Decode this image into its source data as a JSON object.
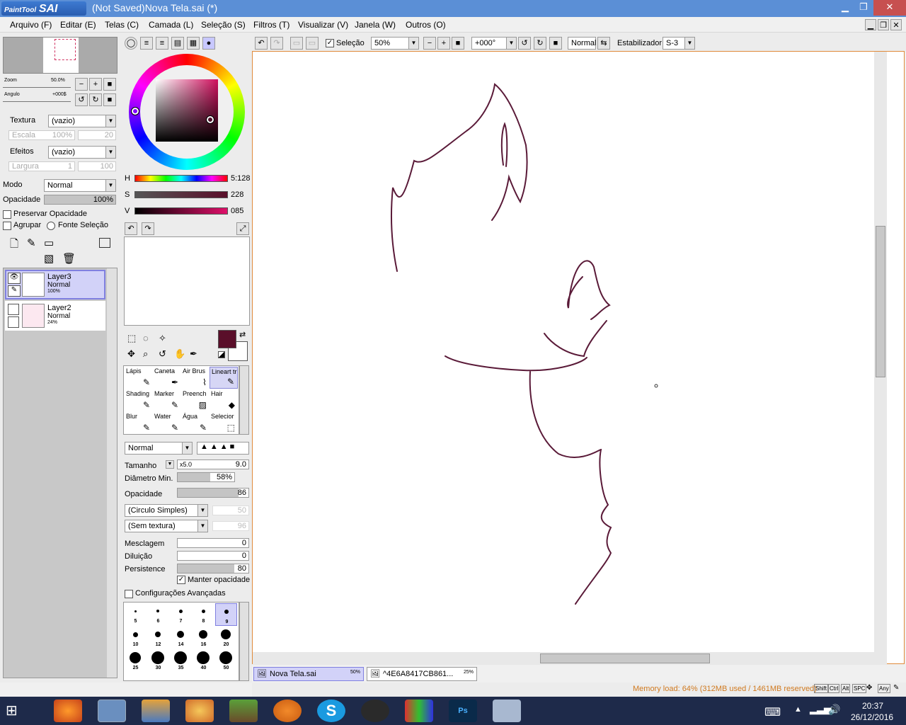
{
  "window": {
    "logo_small": "PaintTool",
    "logo_big": "SAI",
    "title": "(Not Saved)Nova Tela.sai (*)",
    "minimize": "▁",
    "restore": "❐",
    "close": "✕"
  },
  "menu": [
    "Arquivo (F)",
    "Editar (E)",
    "Telas (C)",
    "Camada (L)",
    "Seleção (S)",
    "Filtros (T)",
    "Visualizar (V)",
    "Janela (W)",
    "Outros (O)"
  ],
  "nav": {
    "zoom_label": "Zoom",
    "zoom_value": "50.0%",
    "angle_label": "Angulo",
    "angle_value": "+000$"
  },
  "layer_props": {
    "texture_label": "Textura",
    "texture_value": "(vazio)",
    "scale_label": "Escala",
    "scale_value": "100%",
    "scale_value2": "20",
    "effects_label": "Efeitos",
    "effects_value": "(vazio)",
    "width_label": "Largura",
    "width_value": "1",
    "width_value2": "100",
    "mode_label": "Modo",
    "mode_value": "Normal",
    "opacity_label": "Opacidade",
    "opacity_value": "100%",
    "preserve_opacity": "Preservar Opacidade",
    "group": "Agrupar",
    "selection_source": "Fonte Seleção"
  },
  "layers": [
    {
      "name": "Layer3",
      "mode": "Normal",
      "opacity": "100%",
      "selected": true
    },
    {
      "name": "Layer2",
      "mode": "Normal",
      "opacity": "24%",
      "selected": false
    }
  ],
  "color": {
    "h_label": "H",
    "h_value": "5:128",
    "s_label": "S",
    "s_value": "228",
    "v_label": "V",
    "v_value": "085",
    "primary": "#5a0f2a",
    "secondary": "#ffffff"
  },
  "tools": [
    {
      "name": "Lápis"
    },
    {
      "name": "Caneta"
    },
    {
      "name": "Air Brus"
    },
    {
      "name": "Lineart tr"
    },
    {
      "name": "Shading"
    },
    {
      "name": "Marker"
    },
    {
      "name": "Preench"
    },
    {
      "name": "Hair"
    },
    {
      "name": "Blur"
    },
    {
      "name": "Water"
    },
    {
      "name": "Água"
    },
    {
      "name": "Selecior"
    }
  ],
  "brush": {
    "blend_mode": "Normal",
    "size_label": "Tamanho",
    "size_mult": "x5.0",
    "size_value": "9.0",
    "min_diam_label": "Diâmetro Min.",
    "min_diam_value": "58%",
    "min_diam_fill": 0.58,
    "opacity_label": "Opacidade",
    "opacity_value": "86",
    "opacity_fill": 0.86,
    "shape": "(Circulo Simples)",
    "shape_value": "50",
    "texture": "(Sem textura)",
    "texture_value": "96",
    "blend_label": "Mesclagem",
    "blend_value": "0",
    "dilution_label": "Diluição",
    "dilution_value": "0",
    "persist_label": "Persistence",
    "persist_value": "80",
    "persist_fill": 0.8,
    "keep_opacity": "Manter opacidade",
    "advanced": "Configurações Avançadas"
  },
  "brush_sizes": [
    "5",
    "6",
    "7",
    "8",
    "9",
    "10",
    "12",
    "14",
    "16",
    "20",
    "25",
    "30",
    "35",
    "40",
    "50"
  ],
  "toolbar": {
    "selection": "Seleção",
    "zoom": "50%",
    "angle": "+000°",
    "mode": "Normal",
    "stabilizer_label": "Estabilizador",
    "stabilizer_value": "S-3"
  },
  "tabs": [
    {
      "name": "Nova Tela.sai",
      "zoom": "50%"
    },
    {
      "name": "^4E6A8417CB861...",
      "zoom": "25%"
    }
  ],
  "status": {
    "memory": "Memory load: 64% (312MB used / 1461MB reserved)",
    "keys": [
      "Shift",
      "Ctrl",
      "Alt",
      "SPC",
      "Any"
    ]
  },
  "clock": {
    "time": "20:37",
    "date": "26/12/2016"
  },
  "stroke_color": "#5a1a38"
}
